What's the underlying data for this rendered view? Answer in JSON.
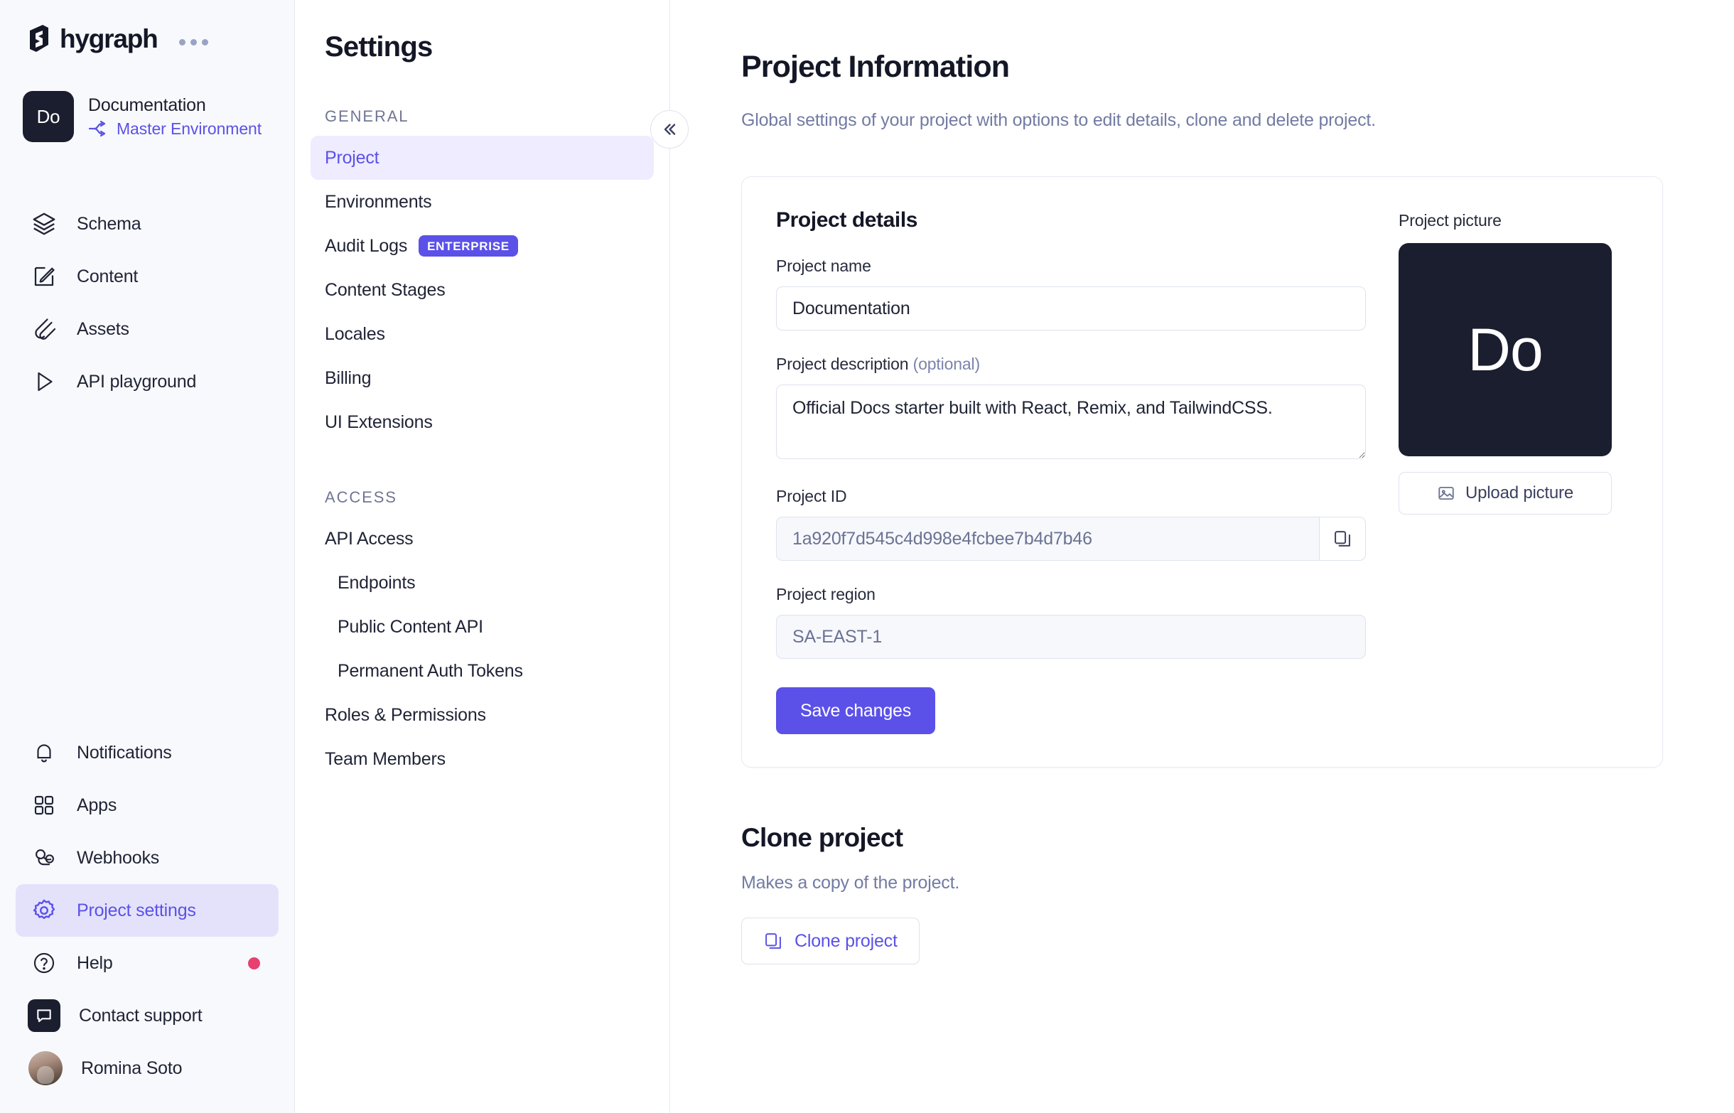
{
  "brand": {
    "name": "hygraph",
    "menu_icon": "kebab-menu-icon"
  },
  "project_switcher": {
    "avatar_initials": "Do",
    "name": "Documentation",
    "environment": "Master Environment",
    "environment_icon": "branch-icon"
  },
  "sidebar": {
    "primary": [
      {
        "label": "Schema",
        "icon": "layers-icon"
      },
      {
        "label": "Content",
        "icon": "edit-square-icon"
      },
      {
        "label": "Assets",
        "icon": "paperclip-icon"
      },
      {
        "label": "API playground",
        "icon": "play-icon"
      }
    ],
    "secondary": [
      {
        "label": "Notifications",
        "icon": "bell-icon"
      },
      {
        "label": "Apps",
        "icon": "grid-icon"
      },
      {
        "label": "Webhooks",
        "icon": "webhook-icon"
      },
      {
        "label": "Project settings",
        "icon": "gear-icon",
        "active": true
      },
      {
        "label": "Help",
        "icon": "question-circle-icon",
        "alert": true
      },
      {
        "label": "Contact support",
        "icon": "chat-icon"
      },
      {
        "label": "Romina Soto",
        "icon": "avatar"
      }
    ]
  },
  "settings": {
    "title": "Settings",
    "collapse_icon": "double-chevron-left-icon",
    "groups": [
      {
        "label": "GENERAL",
        "items": [
          {
            "label": "Project",
            "active": true
          },
          {
            "label": "Environments"
          },
          {
            "label": "Audit Logs",
            "badge": "ENTERPRISE"
          },
          {
            "label": "Content Stages"
          },
          {
            "label": "Locales"
          },
          {
            "label": "Billing"
          },
          {
            "label": "UI Extensions"
          }
        ]
      },
      {
        "label": "ACCESS",
        "items": [
          {
            "label": "API Access"
          },
          {
            "label": "Endpoints",
            "sub": true
          },
          {
            "label": "Public Content API",
            "sub": true
          },
          {
            "label": "Permanent Auth Tokens",
            "sub": true
          },
          {
            "label": "Roles & Permissions"
          },
          {
            "label": "Team Members"
          }
        ]
      }
    ]
  },
  "main": {
    "title": "Project Information",
    "subtitle": "Global settings of your project with options to edit details, clone and delete project.",
    "details": {
      "card_title": "Project details",
      "name_label": "Project name",
      "name_value": "Documentation",
      "description_label": "Project description ",
      "description_optional": "(optional)",
      "description_value": "Official Docs starter built with React, Remix, and TailwindCSS.",
      "id_label": "Project ID",
      "id_value": "1a920f7d545c4d998e4fcbee7b4d7b46",
      "copy_icon": "copy-icon",
      "region_label": "Project region",
      "region_value": "SA-EAST-1",
      "save_label": "Save changes",
      "picture_label": "Project picture",
      "picture_initials": "Do",
      "upload_label": "Upload picture",
      "upload_icon": "image-icon"
    },
    "clone": {
      "title": "Clone project",
      "subtitle": "Makes a copy of the project.",
      "button_label": "Clone project",
      "button_icon": "copy-icon"
    }
  },
  "colors": {
    "accent": "#5b51e8",
    "accent_soft": "#e4e2fb",
    "dark": "#1b1e2e",
    "alert": "#e8406f",
    "muted": "#727ba3"
  }
}
